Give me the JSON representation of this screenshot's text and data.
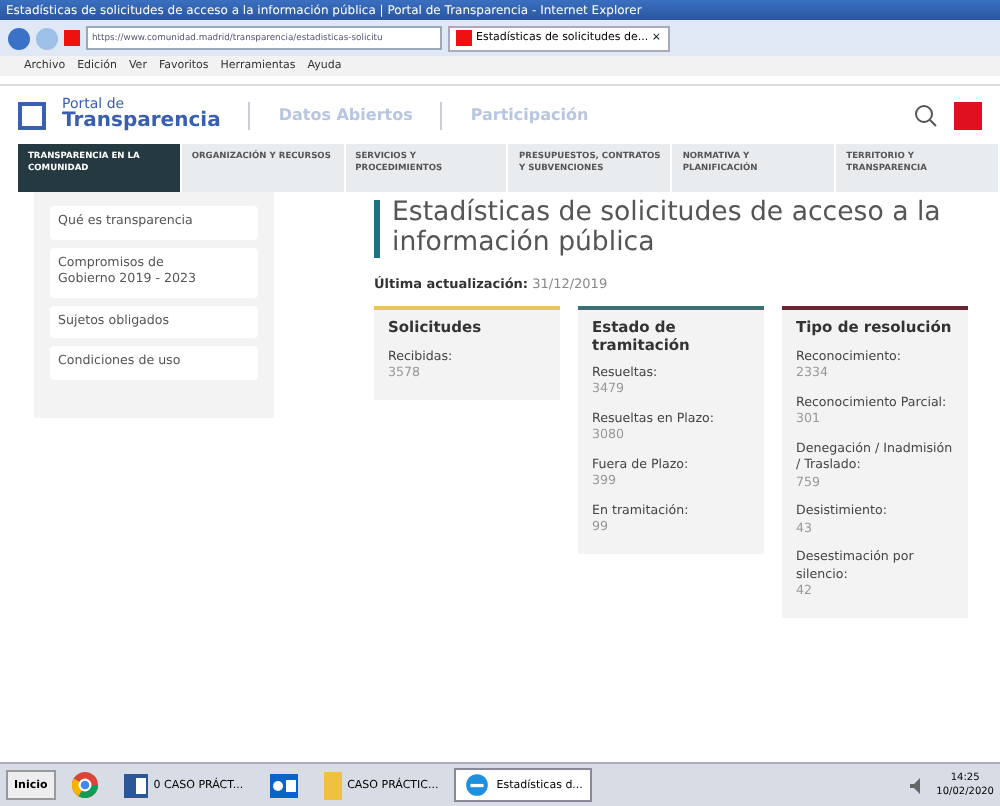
{
  "window": {
    "title": "Estadísticas de solicitudes de acceso a la información pública | Portal de Transparencia - Internet Explorer"
  },
  "browser": {
    "address": "https://www.comunidad.madrid/transparencia/estadisticas-solicitu",
    "tab_title": "Estadísticas de solicitudes de...",
    "tab_close": "×"
  },
  "menu": [
    "Archivo",
    "Edición",
    "Ver",
    "Favoritos",
    "Herramientas",
    "Ayuda"
  ],
  "header": {
    "logo_small": "Portal de",
    "logo_big": "Transparencia",
    "links": [
      "Datos Abiertos",
      "Participación"
    ]
  },
  "nav": [
    {
      "label": "TRANSPARENCIA EN LA COMUNIDAD",
      "selected": true
    },
    {
      "label": "ORGANIZACIÓN Y RECURSOS",
      "selected": false
    },
    {
      "label": "SERVICIOS Y PROCEDIMIENTOS",
      "selected": false
    },
    {
      "label": "PRESUPUESTOS, CONTRATOS Y SUBVENCIONES",
      "selected": false
    },
    {
      "label": "NORMATIVA Y PLANIFICACIÓN",
      "selected": false
    },
    {
      "label": "TERRITORIO Y TRANSPARENCIA",
      "selected": false
    }
  ],
  "sidebar": {
    "items": [
      "Qué es transparencia",
      "Compromisos de Gobierno 2019 - 2023",
      "Sujetos obligados",
      "Condiciones de uso"
    ]
  },
  "page": {
    "title": "Estadísticas de solicitudes de acceso a la información pública",
    "update_label": "Última actualización:",
    "update_value": "31/12/2019"
  },
  "cards": [
    {
      "title": "Solicitudes",
      "color": "#e8c45c",
      "fields": [
        {
          "label": "Recibidas:",
          "value": "3578"
        }
      ]
    },
    {
      "title": "Estado de tramitación",
      "color": "#3d6e72",
      "fields": [
        {
          "label": "Resueltas:",
          "value": "3479"
        },
        {
          "label": "Resueltas en Plazo:",
          "value": "3080"
        },
        {
          "label": "Fuera de Plazo:",
          "value": "399"
        },
        {
          "label": "En tramitación:",
          "value": "99"
        }
      ]
    },
    {
      "title": "Tipo de resolución",
      "color": "#6a2434",
      "fields": [
        {
          "label": "Reconocimiento:",
          "value": "2334"
        },
        {
          "label": "Reconocimiento Parcial:",
          "value": "301"
        },
        {
          "label": "Denegación / Inadmisión / Traslado:",
          "value": "759"
        },
        {
          "label": "Desistimiento:",
          "value": "43"
        },
        {
          "label": "Desestimación por silencio:",
          "value": "42"
        }
      ]
    }
  ],
  "taskbar": {
    "start": "Inicio",
    "items": [
      {
        "kind": "chrome",
        "selected": false
      },
      {
        "kind": "word",
        "label": "0 CASO PRÁCT...",
        "selected": false
      },
      {
        "kind": "outlook",
        "selected": false
      },
      {
        "kind": "folder",
        "label": "CASO PRÁCTIC...",
        "selected": false
      },
      {
        "kind": "ie",
        "label": "Estadísticas d...",
        "selected": true
      }
    ],
    "time": "14:25",
    "date": "10/02/2020"
  }
}
